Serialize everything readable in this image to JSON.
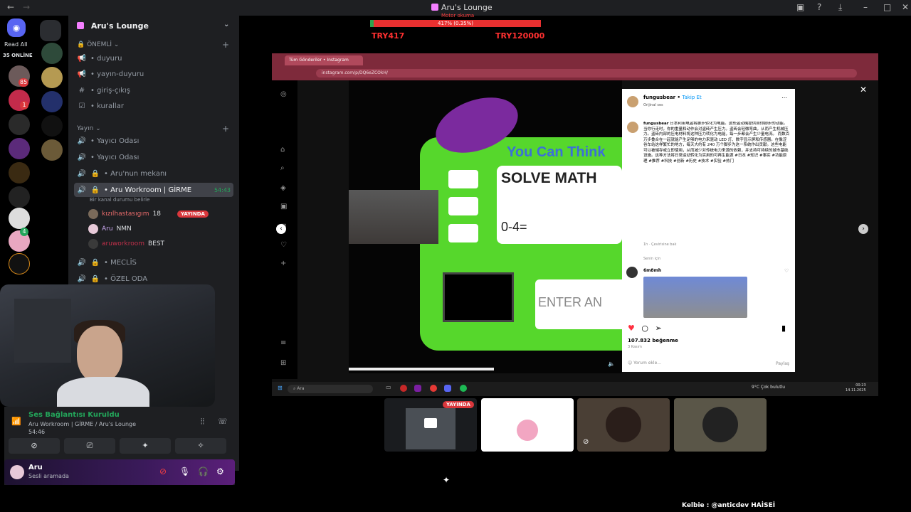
{
  "window": {
    "title": "Aru's Lounge"
  },
  "ticker": {
    "top_label": "Motor okuma",
    "bar_text": "417% (0.35%)",
    "progress": 0.02,
    "low": "TRY417",
    "high": "TRY120000"
  },
  "rail": {
    "read_all": "Read All",
    "online": "35 ONLİNE",
    "badges": {
      "b1": "85",
      "b2": "1",
      "b3": "4"
    }
  },
  "sidebar": {
    "server_name": "Aru's Lounge",
    "categories": {
      "important": "ÖNEMLİ",
      "stream": "Yayın"
    },
    "channels": {
      "duyuru": "• duyuru",
      "yayin_duyuru": "• yayın-duyuru",
      "giris_cikis": "• giriş-çıkış",
      "kurallar": "• kurallar",
      "yayici1": "• Yayıcı Odası",
      "yayici2": "• Yayıcı Odası",
      "mekan": "• Aru'nun mekanı",
      "workroom": "• Aru Workroom | GİRME",
      "meclis": "• MECLİS",
      "ozel": "• ÖZEL ODA"
    },
    "workroom_time": "54:43",
    "workroom_status": "Bir kanal durumu belirle",
    "voice_users": [
      {
        "name": "kızılhastasıgım",
        "tag": "18",
        "live": "YAYINDA"
      },
      {
        "name": "Aru",
        "tag": "NMN"
      },
      {
        "name": "aruworkroom",
        "tag": "BEST"
      }
    ]
  },
  "voice_panel": {
    "status": "Ses Bağlantısı Kuruldu",
    "channel": "Aru Workroom | GİRME / Aru's Lounge",
    "time": "54:46"
  },
  "user": {
    "name": "Aru",
    "status": "Sesli aramada"
  },
  "share": {
    "tab_title": "Tüm Gönderiler • Instagram",
    "url": "instagram.com/p/DQ6eZCOkH/",
    "video": {
      "title": "You Can Think",
      "panel": "SOLVE MATH",
      "expr": "0-4=",
      "enter": "ENTER AN"
    },
    "post": {
      "author": "fungusbear",
      "follow": "Takip Et",
      "audio": "Orijinal ses",
      "caption": "日本利用电盗将脚步转化为电能。这些盗动械提供自你脚步的动能。当你行走时，你的重量和动作会对盗砖产生压力。盗砖会轻微弯曲，从而产生机械压力。盗砖内部的压电材料将这种压力转化为电能，每一步都会产生少量电流。 而数百万步叠合在一起就能产生足够的电力来驱动 LED 灯、数字显示屏和传感器。在像涩谷车站这样繁忙的地方，每天大约有 240 万个脚步为这一系统作出贡献。这些电能可以被储存或立即使用，从而减少对传统电力来源的依赖，并支持可持续的城市基础设施。这种方法将日常运动转化为实用的可再生能源 #日本 #知识 #事实 #功能原理 #推荐 #科技 #创新 #历史 #技术 #实验 #热门",
      "translate": "1h · Çevirisine bak",
      "for_you": "Senin için",
      "commenter": "6m8mh",
      "likes": "107.832 beğenme",
      "date": "3 Kasım",
      "comment_placeholder": "Yorum ekle...",
      "share": "Paylaş"
    },
    "taskbar": {
      "search": "Ara",
      "weather": "9°C  Çok bulutlu",
      "time": "00:23",
      "date": "14.11.2025"
    }
  },
  "tiles": {
    "live": "YAYINDA"
  },
  "credit": "Kelbie : @anticdev HAİSEİ"
}
